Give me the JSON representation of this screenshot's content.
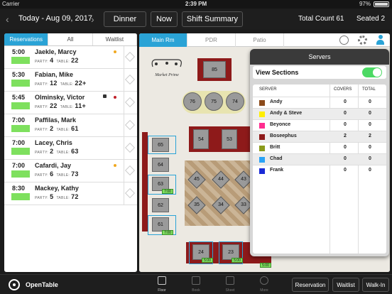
{
  "status_bar": {
    "carrier": "Carrier",
    "time": "2:39 PM",
    "battery": "97%"
  },
  "top_bar": {
    "date": "Today - Aug 09, 2017",
    "service": "Dinner",
    "now": "Now",
    "shift_summary": "Shift Summary",
    "total_count": "Total Count 61",
    "seated": "Seated 2"
  },
  "reservations_panel": {
    "tabs": [
      "Reservations",
      "All",
      "Waitlist"
    ],
    "meta_labels": {
      "party": "PARTY:",
      "table": "TABLE:"
    },
    "rows": [
      {
        "time": "5:00",
        "name": "Jaekle, Marcy",
        "party": "4",
        "table": "22"
      },
      {
        "time": "5:30",
        "name": "Fabian, Mike",
        "party": "12",
        "table": "22+"
      },
      {
        "time": "5:45",
        "name": "Olminsky, Victor",
        "party": "22",
        "table": "11+"
      },
      {
        "time": "7:00",
        "name": "Paffilas, Mark",
        "party": "2",
        "table": "61"
      },
      {
        "time": "7:00",
        "name": "Lacey, Chris",
        "party": "2",
        "table": "63"
      },
      {
        "time": "7:00",
        "name": "Cafardi, Jay",
        "party": "6",
        "table": "73"
      },
      {
        "time": "8:30",
        "name": "Mackey, Kathy",
        "party": "5",
        "table": "72"
      }
    ]
  },
  "floor_tabs": [
    "Main Rm",
    "PDR",
    "Patio"
  ],
  "floor": {
    "logo": "Market Prime",
    "tables_top": [
      "85"
    ],
    "round_tables": [
      "76",
      "75",
      "74"
    ],
    "booths": [
      "54",
      "53"
    ],
    "column_tables": [
      "65",
      "64",
      "63",
      "62",
      "61"
    ],
    "diamonds": [
      "45",
      "44",
      "43",
      "35",
      "34",
      "33"
    ],
    "bottom_tables": [
      "24",
      "23"
    ],
    "tags": [
      "7:00",
      "7:00",
      "5:00",
      "5:00",
      "5:00"
    ]
  },
  "servers_popover": {
    "title": "Servers",
    "view_sections": "View Sections",
    "headers": {
      "server": "SERVER",
      "covers": "COVERS",
      "total": "TOTAL"
    },
    "rows": [
      {
        "name": "Andy",
        "covers": "0",
        "total": "0",
        "color": "#8b4a1a"
      },
      {
        "name": "Andy  & Steve",
        "covers": "0",
        "total": "0",
        "color": "#ffee00"
      },
      {
        "name": "Beyonce",
        "covers": "0",
        "total": "0",
        "color": "#ff2d8f"
      },
      {
        "name": "Boseephus",
        "covers": "2",
        "total": "2",
        "color": "#8e1a1a"
      },
      {
        "name": "Britt",
        "covers": "0",
        "total": "0",
        "color": "#8a9a1a"
      },
      {
        "name": "Chad",
        "covers": "0",
        "total": "0",
        "color": "#2aa3f6"
      },
      {
        "name": "Frank",
        "covers": "0",
        "total": "0",
        "color": "#1a2ad6"
      }
    ]
  },
  "bottom_bar": {
    "logo": "OpenTable",
    "nav": [
      "Floor",
      "Book",
      "Sheet",
      "More"
    ],
    "buttons": [
      "Reservation",
      "Waitlist",
      "Walk-In"
    ]
  },
  "colors": {
    "accent": "#2aa3d6",
    "seated_green": "#7ee05e",
    "toggle_on": "#4cd964"
  }
}
